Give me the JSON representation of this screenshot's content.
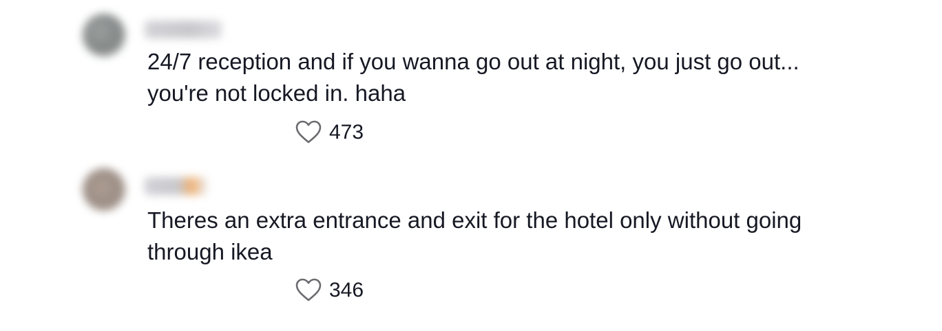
{
  "comments": [
    {
      "text": "24/7 reception and if you wanna go out at night, you just go out...\nyou're not locked in. haha",
      "likes": "473"
    },
    {
      "text": "Theres an extra entrance and exit for the hotel only without going\nthrough ikea",
      "likes": "346"
    }
  ],
  "icons": {
    "like": "heart-outline-icon"
  },
  "colors": {
    "text": "#161823",
    "icon_stroke": "#6b6b70"
  }
}
